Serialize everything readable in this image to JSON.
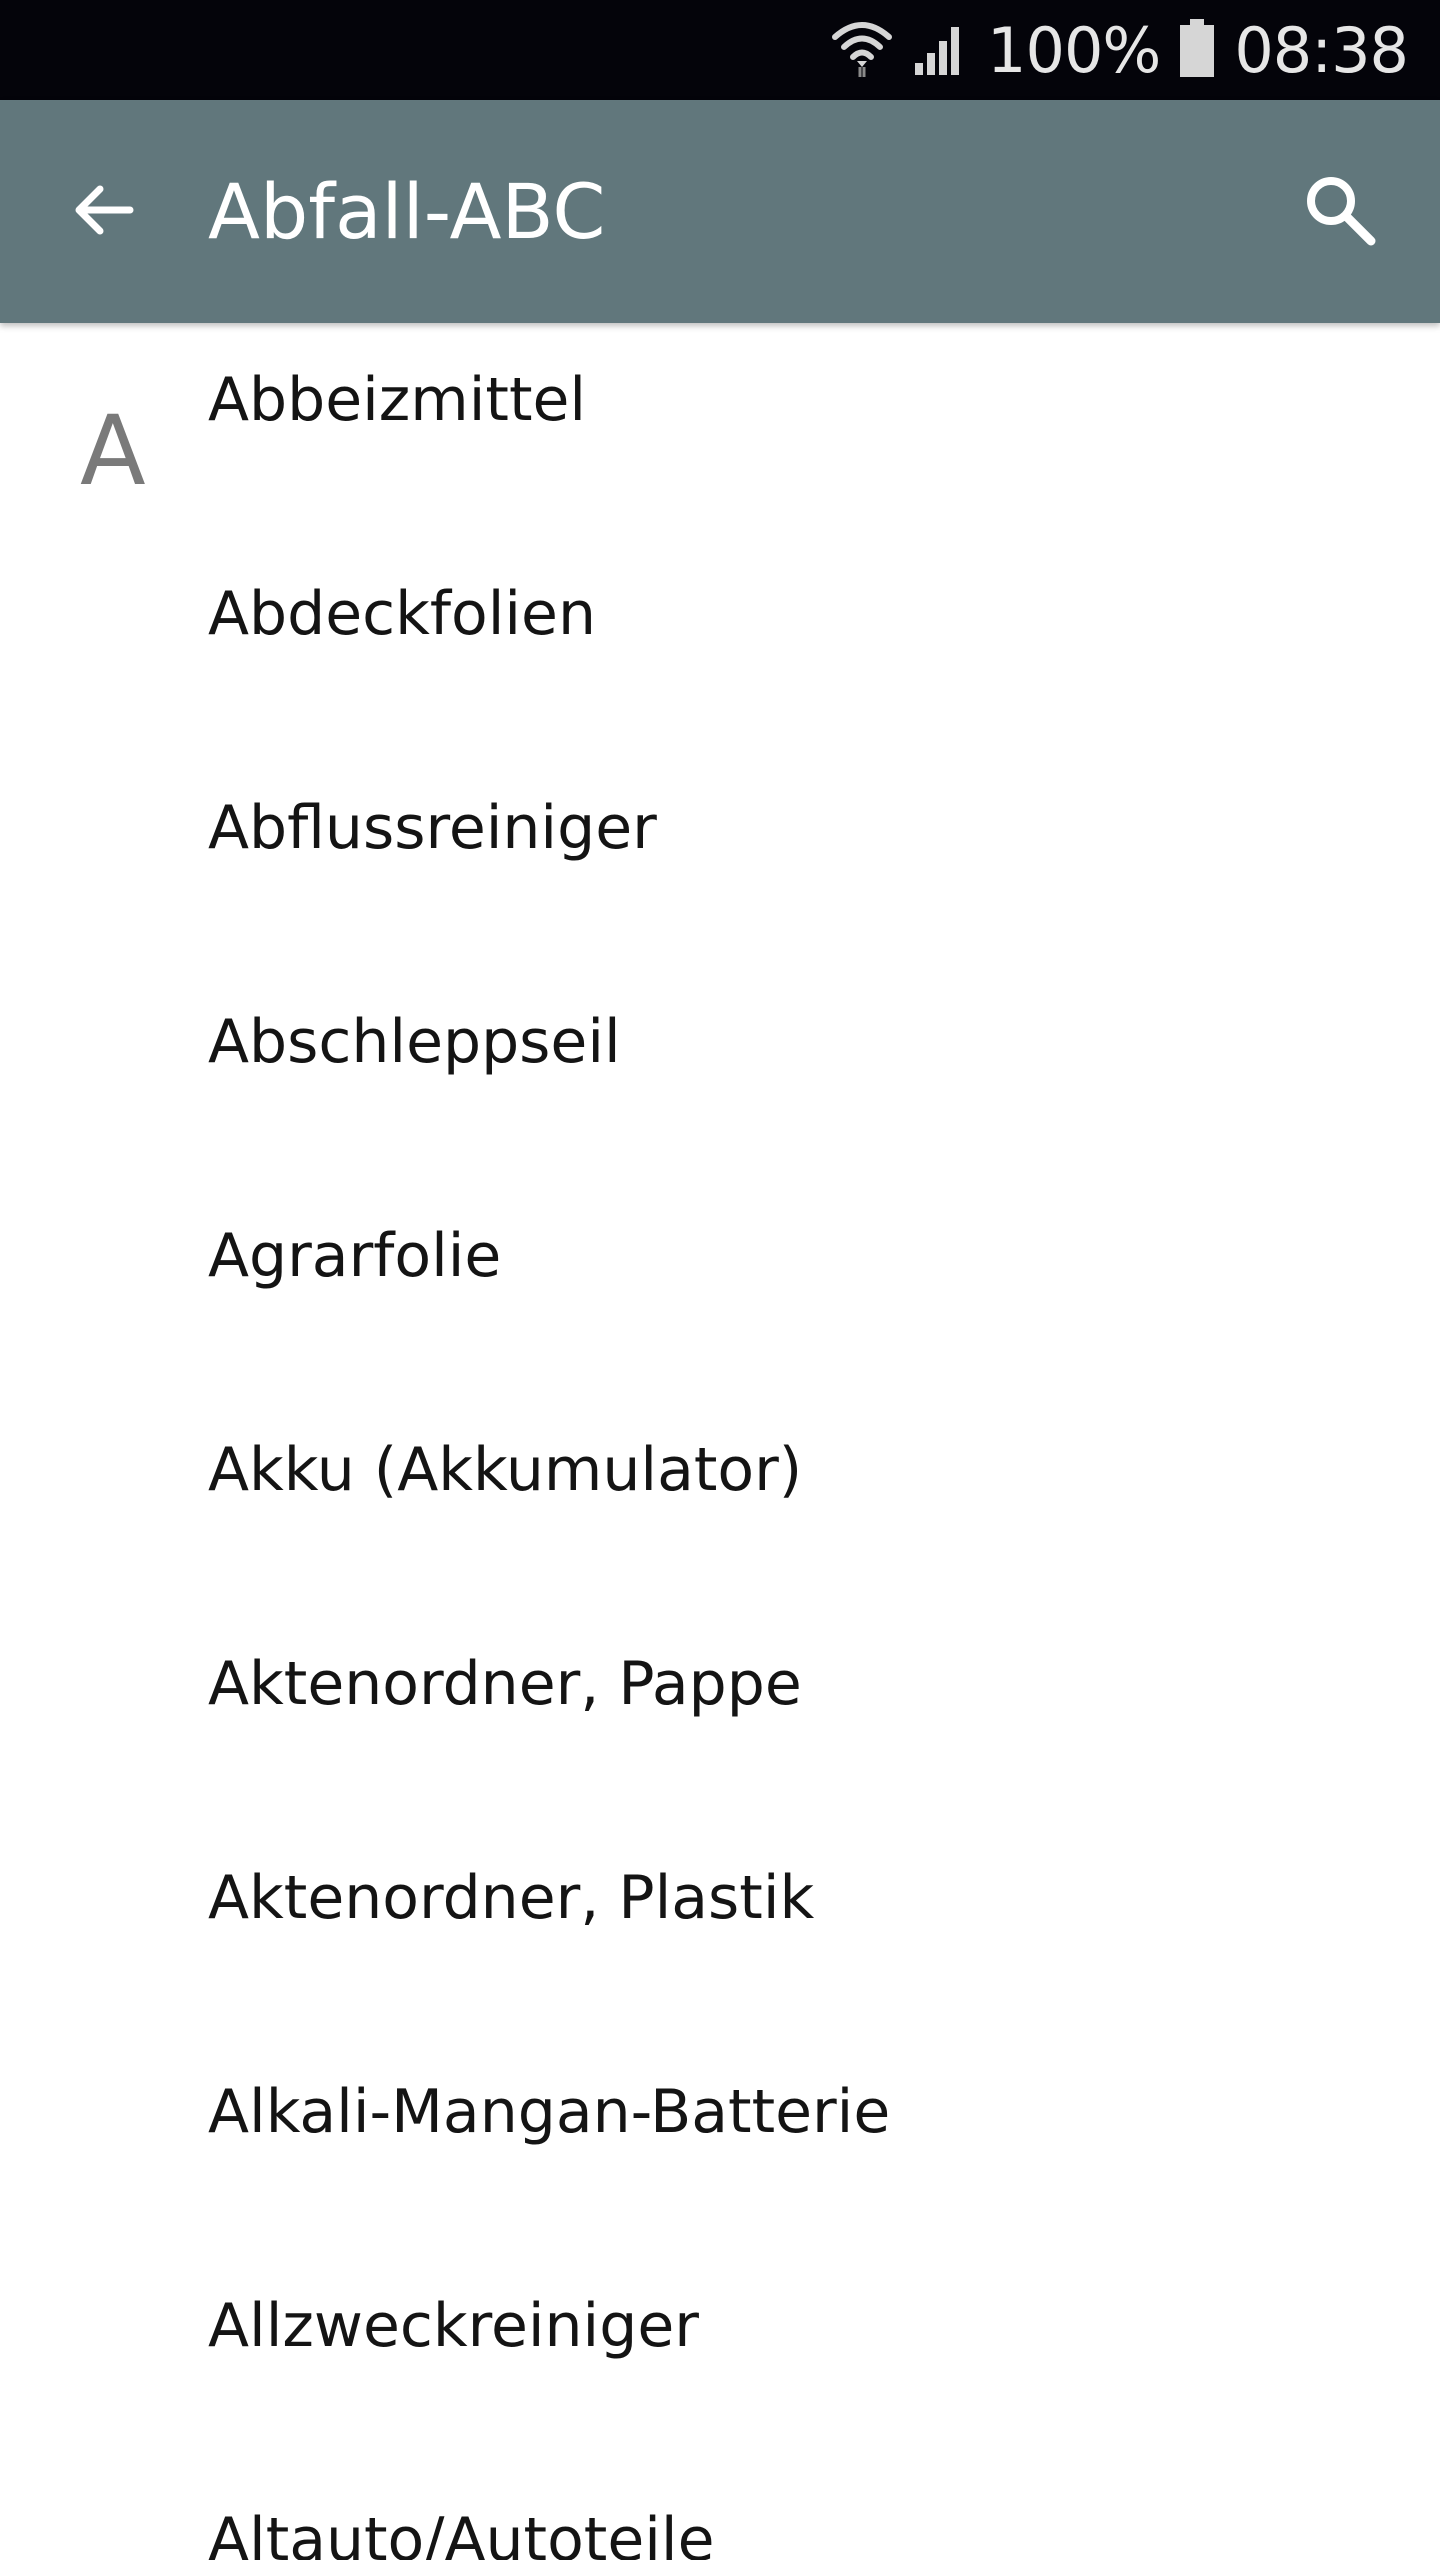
{
  "status_bar": {
    "battery_text": "100%",
    "time": "08:38",
    "icons": [
      "wifi-icon",
      "signal-icon",
      "battery-icon"
    ]
  },
  "app_bar": {
    "title": "Abfall-ABC",
    "back_icon": "arrow-back-icon",
    "search_icon": "search-icon",
    "color": "#61777c"
  },
  "list": {
    "section": "A",
    "items": [
      "Abbeizmittel",
      "Abdeckfolien",
      "Abflussreiniger",
      "Abschleppseil",
      "Agrarfolie",
      "Akku (Akkumulator)",
      "Aktenordner, Pappe",
      "Aktenordner, Plastik",
      "Alkali-Mangan-Batterie",
      "Allzweckreiniger",
      "Altauto/Autoteile"
    ]
  }
}
